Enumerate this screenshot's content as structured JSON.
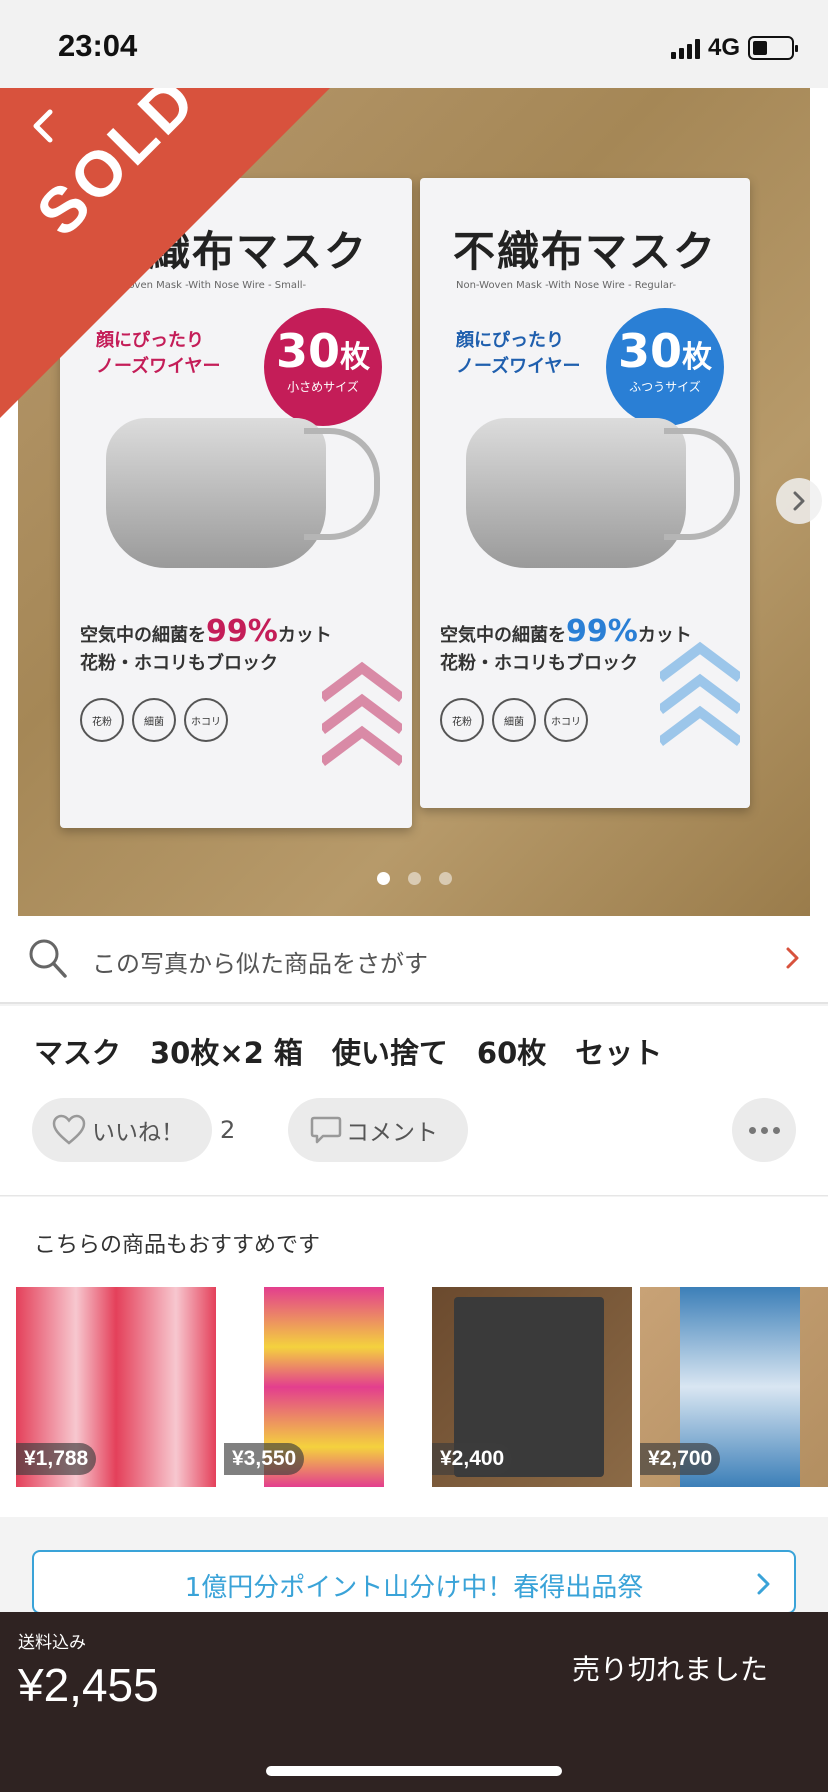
{
  "status_bar": {
    "time": "23:04",
    "network": "4G"
  },
  "photo": {
    "sold_label": "SOLD",
    "page_count": 3,
    "current_page": 1,
    "left_box": {
      "title": "不織布マスク",
      "subtitle": "Non-Woven Mask -With Nose Wire - Small-",
      "catch": [
        "顔にぴったり",
        "ノーズワイヤー"
      ],
      "badge_num": "30",
      "badge_unit": "枚",
      "badge_size": "小さめサイズ",
      "copy_line1_pre": "空気中の細菌を",
      "copy_pct": "99%",
      "copy_line1_post": "カット",
      "copy_line2": "花粉・ホコリもブロック",
      "icons": [
        "花粉",
        "細菌",
        "ホコリ"
      ]
    },
    "right_box": {
      "title": "不織布マスク",
      "subtitle": "Non-Woven Mask -With Nose Wire - Regular-",
      "catch": [
        "顔にぴったり",
        "ノーズワイヤー"
      ],
      "badge_num": "30",
      "badge_unit": "枚",
      "badge_size": "ふつうサイズ",
      "copy_line1_pre": "空気中の細菌を",
      "copy_pct": "99%",
      "copy_line1_post": "カット",
      "copy_line2": "花粉・ホコリもブロック",
      "icons": [
        "花粉",
        "細菌",
        "ホコリ"
      ]
    }
  },
  "photo_search": {
    "label": "この写真から似た商品をさがす"
  },
  "item": {
    "title": "マスク　30枚×2 箱　使い捨て　60枚　セット",
    "like_label": "いいね！",
    "like_count": "2",
    "comment_label": "コメント"
  },
  "recommend": {
    "heading": "こちらの商品もおすすめです",
    "items": [
      {
        "price": "¥1,788"
      },
      {
        "price": "¥3,550"
      },
      {
        "price": "¥2,400"
      },
      {
        "price": "¥2,700"
      }
    ]
  },
  "banner": {
    "label": "1億円分ポイント山分け中！春得出品祭"
  },
  "footer": {
    "shipping_label": "送料込み",
    "price": "¥2,455",
    "status": "売り切れました"
  },
  "colors": {
    "sold": "#d8523d",
    "accent_blue": "#3aa3d8",
    "footer_bg": "#2f2322",
    "chevron_red": "#d8523d"
  }
}
